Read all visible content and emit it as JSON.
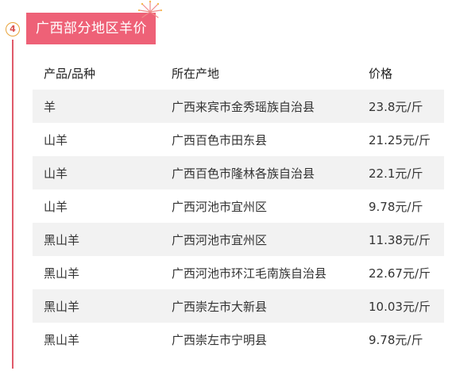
{
  "section": {
    "number": "4",
    "title": "广西部分地区羊价"
  },
  "colors": {
    "accent": "#ee6177",
    "number_ring": "#e8a33a",
    "row_shade": "#f2f2f2"
  },
  "table": {
    "headers": [
      "产品/品种",
      "所在产地",
      "价格"
    ],
    "rows": [
      [
        "羊",
        "广西来宾市金秀瑶族自治县",
        "23.8元/斤"
      ],
      [
        "山羊",
        "广西百色市田东县",
        "21.25元/斤"
      ],
      [
        "山羊",
        "广西百色市隆林各族自治县",
        "22.1元/斤"
      ],
      [
        "山羊",
        "广西河池市宜州区",
        "9.78元/斤"
      ],
      [
        "黑山羊",
        "广西河池市宜州区",
        "11.38元/斤"
      ],
      [
        "黑山羊",
        "广西河池市环江毛南族自治县",
        "22.67元/斤"
      ],
      [
        "黑山羊",
        "广西崇左市大新县",
        "10.03元/斤"
      ],
      [
        "黑山羊",
        "广西崇左市宁明县",
        "9.78元/斤"
      ]
    ]
  }
}
